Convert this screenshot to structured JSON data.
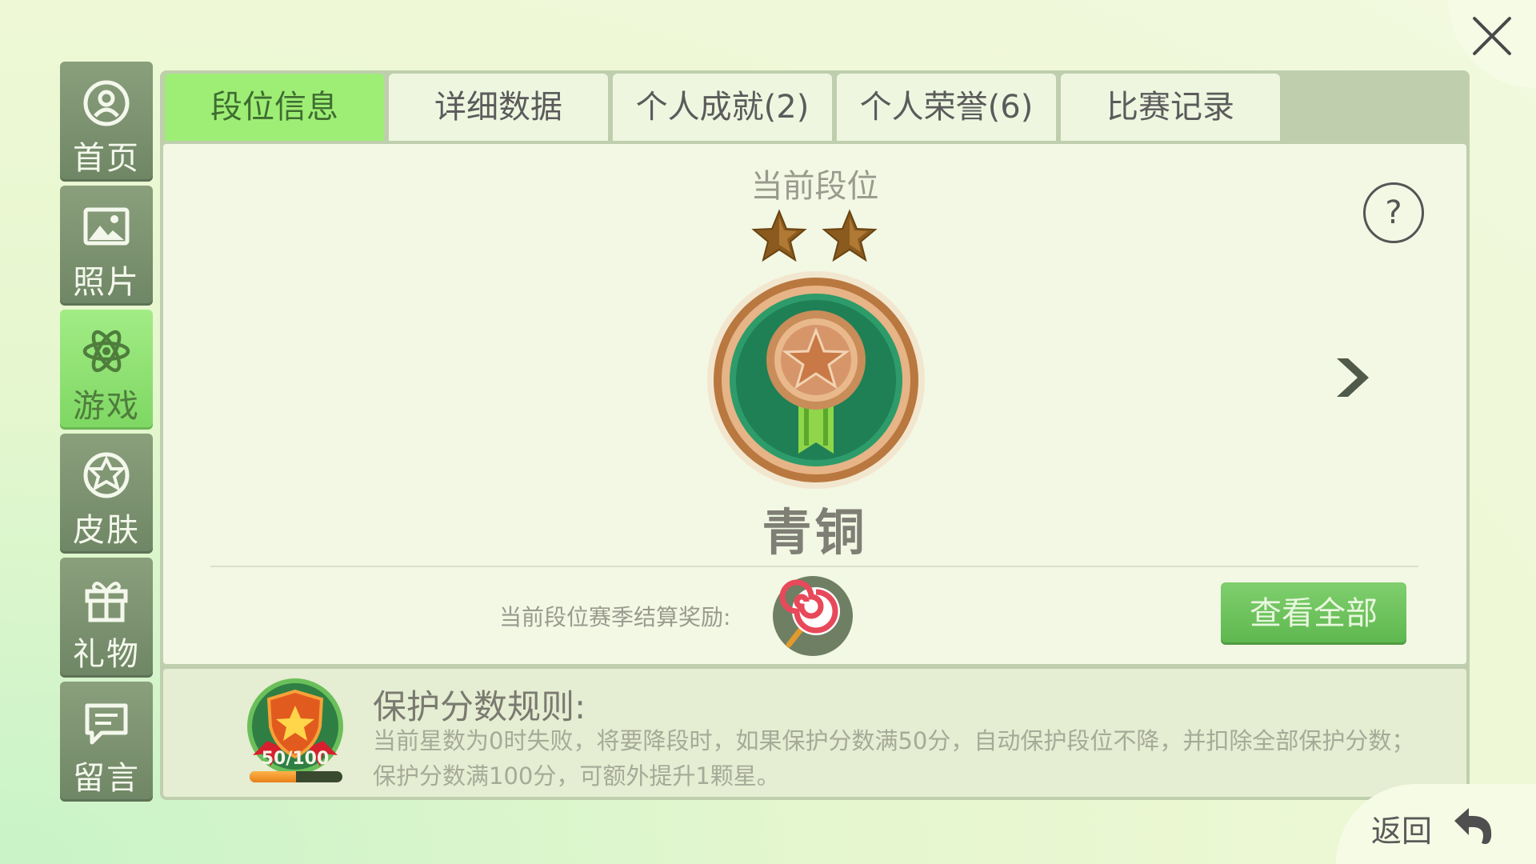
{
  "sidebar": {
    "items": [
      {
        "label": "首页",
        "icon": "home-icon"
      },
      {
        "label": "照片",
        "icon": "photo-icon"
      },
      {
        "label": "游戏",
        "icon": "game-icon"
      },
      {
        "label": "皮肤",
        "icon": "skin-icon"
      },
      {
        "label": "礼物",
        "icon": "gift-icon"
      },
      {
        "label": "留言",
        "icon": "message-icon"
      }
    ],
    "active_index": 2
  },
  "tabs": [
    {
      "label": "段位信息"
    },
    {
      "label": "详细数据"
    },
    {
      "label": "个人成就(2)"
    },
    {
      "label": "个人荣誉(6)"
    },
    {
      "label": "比赛记录"
    }
  ],
  "rank": {
    "caption": "当前段位",
    "stars": 2,
    "name": "青铜",
    "help": "?"
  },
  "reward": {
    "label": "当前段位赛季结算奖励:",
    "icon": "lollipop-icon",
    "view_all": "查看全部"
  },
  "protection": {
    "progress_text": "50/100",
    "progress_fraction": 0.5,
    "title": "保护分数规则:",
    "text": "当前星数为0时失败，将要降段时，如果保护分数满50分，自动保护段位不降，并扣除全部保护分数；保护分数满100分，可额外提升1颗星。"
  },
  "footer": {
    "back_label": "返回"
  },
  "colors": {
    "active_tab": "#9eee76",
    "active_side": "#a2ec86",
    "button_green": "#5eb74e"
  }
}
